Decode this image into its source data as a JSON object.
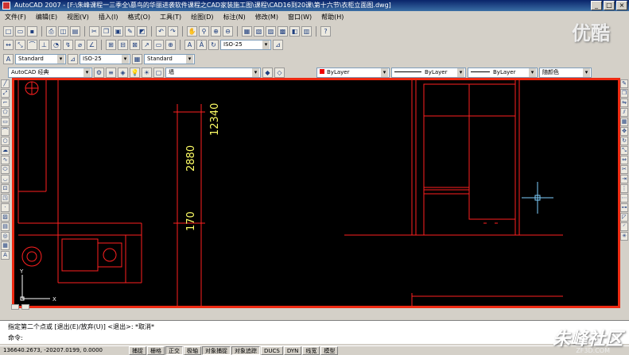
{
  "window": {
    "title": "AutoCAD 2007 - [F:\\朱峰课程一三季全\\慕鸟的华丽进袭软件课程之CAD家装施工图\\课程\\CAD16到20课\\第十六节\\衣柜立面图.dwg]",
    "controls": [
      "_",
      "□",
      "×"
    ]
  },
  "menus": [
    "文件(F)",
    "编辑(E)",
    "视图(V)",
    "插入(I)",
    "格式(O)",
    "工具(T)",
    "绘图(D)",
    "标注(N)",
    "修改(M)",
    "窗口(W)",
    "帮助(H)"
  ],
  "watermark_logo": "优酷",
  "styles_toolbar": {
    "text_style": "Standard",
    "dim_style": "ISO-25",
    "table_style": "Standard",
    "multileader_style": "ISO-25"
  },
  "workspace": {
    "name": "AutoCAD 经典",
    "layer": "墙"
  },
  "properties_toolbar": {
    "color": "ByLayer",
    "linetype": "ByLayer",
    "lineweight": "ByLayer",
    "plotstyle": "随颜色"
  },
  "drawing": {
    "dim_total": "12340",
    "dim_upper": "2880",
    "dim_lower": "170"
  },
  "command": {
    "prompt_line": "指定第二个点或 [退出(E)/放弃(U)] <退出>:  *取消*",
    "input_label": "命令:"
  },
  "status": {
    "coordinates": "136640.2673, -20207.0199, 0.0000",
    "toggles": [
      {
        "label": "捕捉",
        "on": false
      },
      {
        "label": "栅格",
        "on": false
      },
      {
        "label": "正交",
        "on": true
      },
      {
        "label": "极轴",
        "on": false
      },
      {
        "label": "对象捕捉",
        "on": true
      },
      {
        "label": "对象追踪",
        "on": true
      },
      {
        "label": "DUCS",
        "on": false
      },
      {
        "label": "DYN",
        "on": false
      },
      {
        "label": "线宽",
        "on": false
      },
      {
        "label": "模型",
        "on": false
      }
    ]
  },
  "watermark_site": "朱峰社区",
  "watermark_url": "ZF3D.COM",
  "colors": {
    "accent_border": "#ee2a12",
    "drawing_line": "#ff2020",
    "dimension_text": "#ffff66",
    "crosshair": "#7fd0ff"
  }
}
